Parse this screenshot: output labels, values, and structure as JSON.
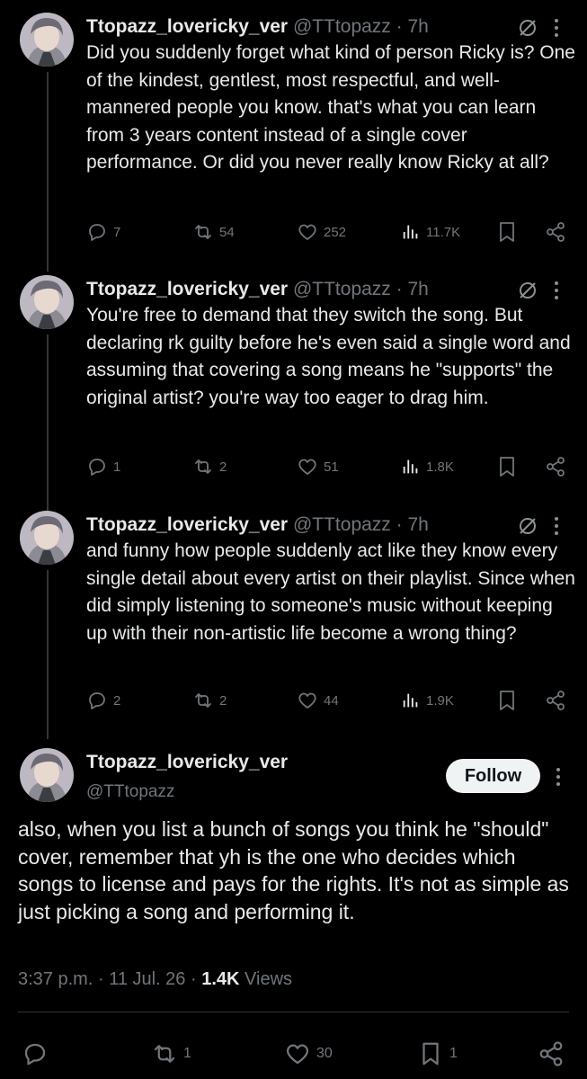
{
  "author": {
    "name": "Ttopazz_lovericky_ver",
    "handle": "@TTtopazz"
  },
  "thread": [
    {
      "time": "7h",
      "text": "Did you suddenly forget what kind of person Ricky is? One of the kindest, gentlest, most respectful, and well-mannered people you know. that's what you can learn from 3 years content instead of a single cover performance. Or did you never really know Ricky at all?",
      "replies": "7",
      "reposts": "54",
      "likes": "252",
      "views": "11.7K"
    },
    {
      "time": "7h",
      "text": "You're free to demand that they switch the song. But declaring rk guilty before he's even said a single word and assuming that covering a song means he \"supports\" the original artist? you're way  too eager to drag him.",
      "replies": "1",
      "reposts": "2",
      "likes": "51",
      "views": "1.8K"
    },
    {
      "time": "7h",
      "text": "and funny how people suddenly act like they know every single detail about every artist on their playlist. Since when did simply listening to someone's music without keeping up with their non-artistic life become a wrong thing?",
      "replies": "2",
      "reposts": "2",
      "likes": "44",
      "views": "1.9K"
    }
  ],
  "main_tweet": {
    "follow_label": "Follow",
    "text": "also, when you list a bunch of songs you think he \"should\" cover, remember that yh is the one who decides which songs to license and pays for the rights. It's not as simple as just picking a song and performing it.",
    "time": "3:37 p.m.",
    "date": "11 Jul. 26",
    "views_count": "1.4K",
    "views_label": "Views",
    "reposts": "1",
    "likes": "30",
    "bookmarks": "1"
  },
  "separator": "·",
  "icons": [
    "reply-icon",
    "repost-icon",
    "like-icon",
    "views-icon",
    "bookmark-icon",
    "share-icon",
    "mute-icon",
    "more-icon"
  ],
  "colors": {
    "background": "#000000",
    "text": "#e7e9ea",
    "secondary": "#71767b",
    "follow_bg": "#eff3f4"
  }
}
